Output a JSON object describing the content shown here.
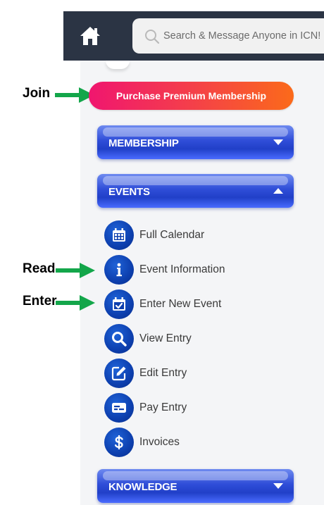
{
  "header": {
    "search_placeholder": "Search & Message Anyone in ICN!"
  },
  "annotations": {
    "join": "Join",
    "read": "Read",
    "enter": "Enter",
    "arrow_color": "#13a64a"
  },
  "purchase_label": "Purchase Premium Membership",
  "sections": {
    "membership": "MEMBERSHIP",
    "events": "EVENTS",
    "knowledge": "KNOWLEDGE"
  },
  "events_menu": [
    {
      "label": "Full Calendar",
      "icon": "calendar-icon"
    },
    {
      "label": "Event Information",
      "icon": "info-icon"
    },
    {
      "label": "Enter New Event",
      "icon": "calendar-check-icon"
    },
    {
      "label": "View Entry",
      "icon": "search-icon"
    },
    {
      "label": "Edit Entry",
      "icon": "edit-icon"
    },
    {
      "label": "Pay Entry",
      "icon": "payment-card-icon"
    },
    {
      "label": "Invoices",
      "icon": "dollar-icon"
    }
  ],
  "colors": {
    "topbar": "#2b3444",
    "section_blue": "#2f4dd8",
    "icon_blue": "#0d3fae",
    "purchase_start": "#f0166f",
    "purchase_end": "#fb6a1a"
  }
}
